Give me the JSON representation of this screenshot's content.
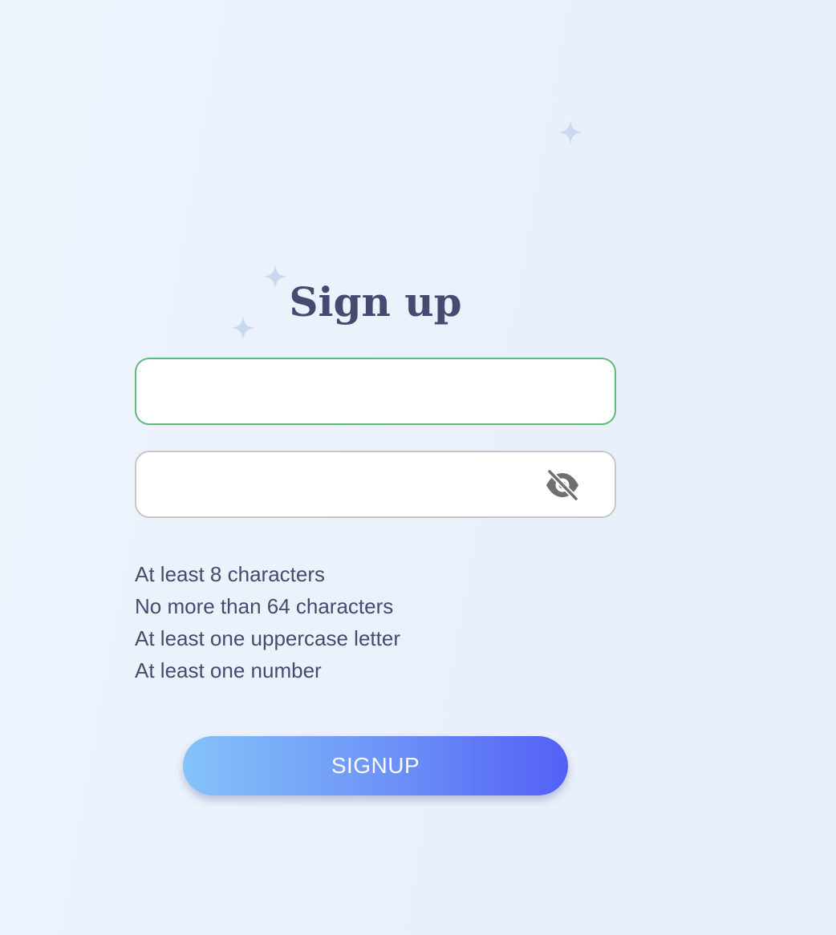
{
  "form": {
    "title": "Sign up",
    "username": {
      "value": "",
      "placeholder": ""
    },
    "password": {
      "value": "",
      "placeholder": "",
      "toggle_icon": "eye-slash-icon"
    },
    "rules": [
      "At least 8 characters",
      "No more than 64 characters",
      "At least one uppercase letter",
      "At least one number"
    ],
    "submit_label": "SIGNUP"
  },
  "decorations": {
    "sparkle_icon": "sparkle-icon",
    "sparkle_color": "#c9d8ee"
  },
  "colors": {
    "title": "#474a70",
    "valid_border": "#5dba7a",
    "default_border": "#c7c7c9",
    "button_gradient_start": "#84c3f9",
    "button_gradient_end": "#5360f5"
  }
}
